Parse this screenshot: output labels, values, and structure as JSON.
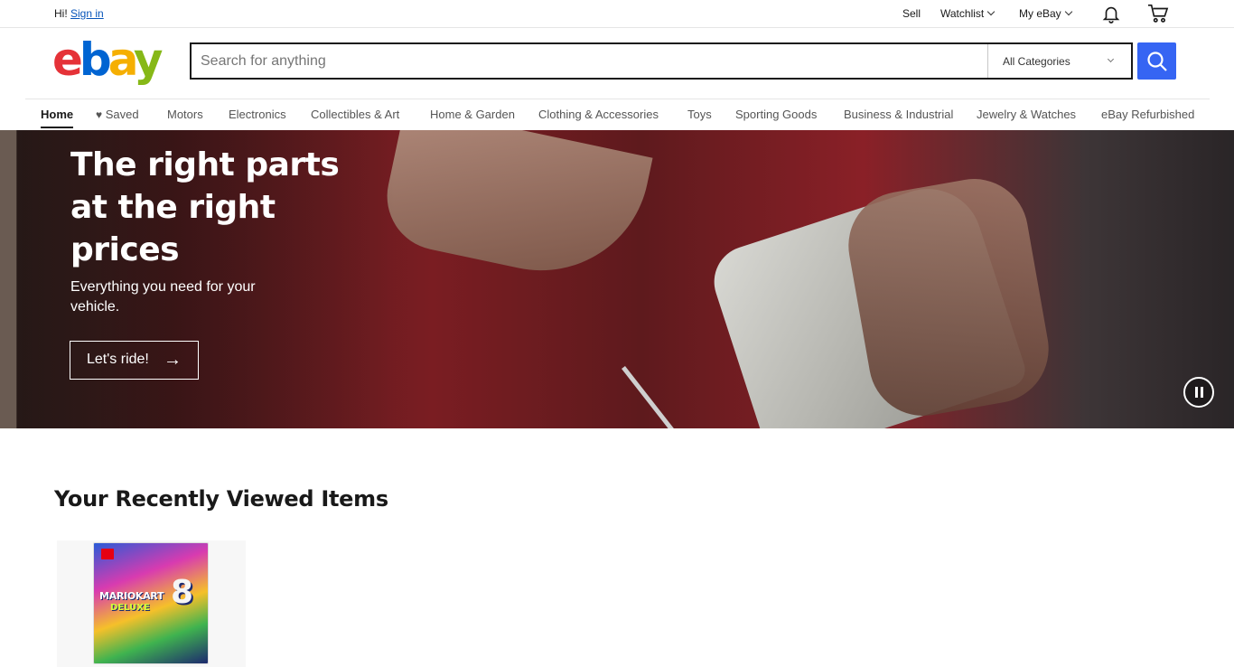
{
  "topbar": {
    "greeting": "Hi!",
    "sign_in": "Sign in",
    "sell": "Sell",
    "watchlist": "Watchlist",
    "my_ebay": "My eBay"
  },
  "logo": {
    "letters": [
      "e",
      "b",
      "a",
      "y"
    ]
  },
  "search": {
    "placeholder": "Search for anything",
    "category": "All Categories"
  },
  "nav": {
    "items": [
      "Home",
      "Saved",
      "Motors",
      "Electronics",
      "Collectibles & Art",
      "Home & Garden",
      "Clothing & Accessories",
      "Toys",
      "Sporting Goods",
      "Business & Industrial",
      "Jewelry & Watches",
      "eBay Refurbished"
    ],
    "active": "Home"
  },
  "hero": {
    "title": "The right parts at the right prices",
    "subtitle": "Everything you need for your vehicle.",
    "cta": "Let's ride!"
  },
  "recently_viewed": {
    "title": "Your Recently Viewed Items",
    "items": [
      {
        "cover_title": "MARIOKART",
        "cover_subtitle": "DELUXE",
        "cover_number": "8"
      }
    ]
  },
  "colors": {
    "accent": "#3665f3",
    "link": "#0654ba",
    "logo_e": "#e53238",
    "logo_b": "#0064d2",
    "logo_a": "#f5af02",
    "logo_y": "#86b817"
  }
}
